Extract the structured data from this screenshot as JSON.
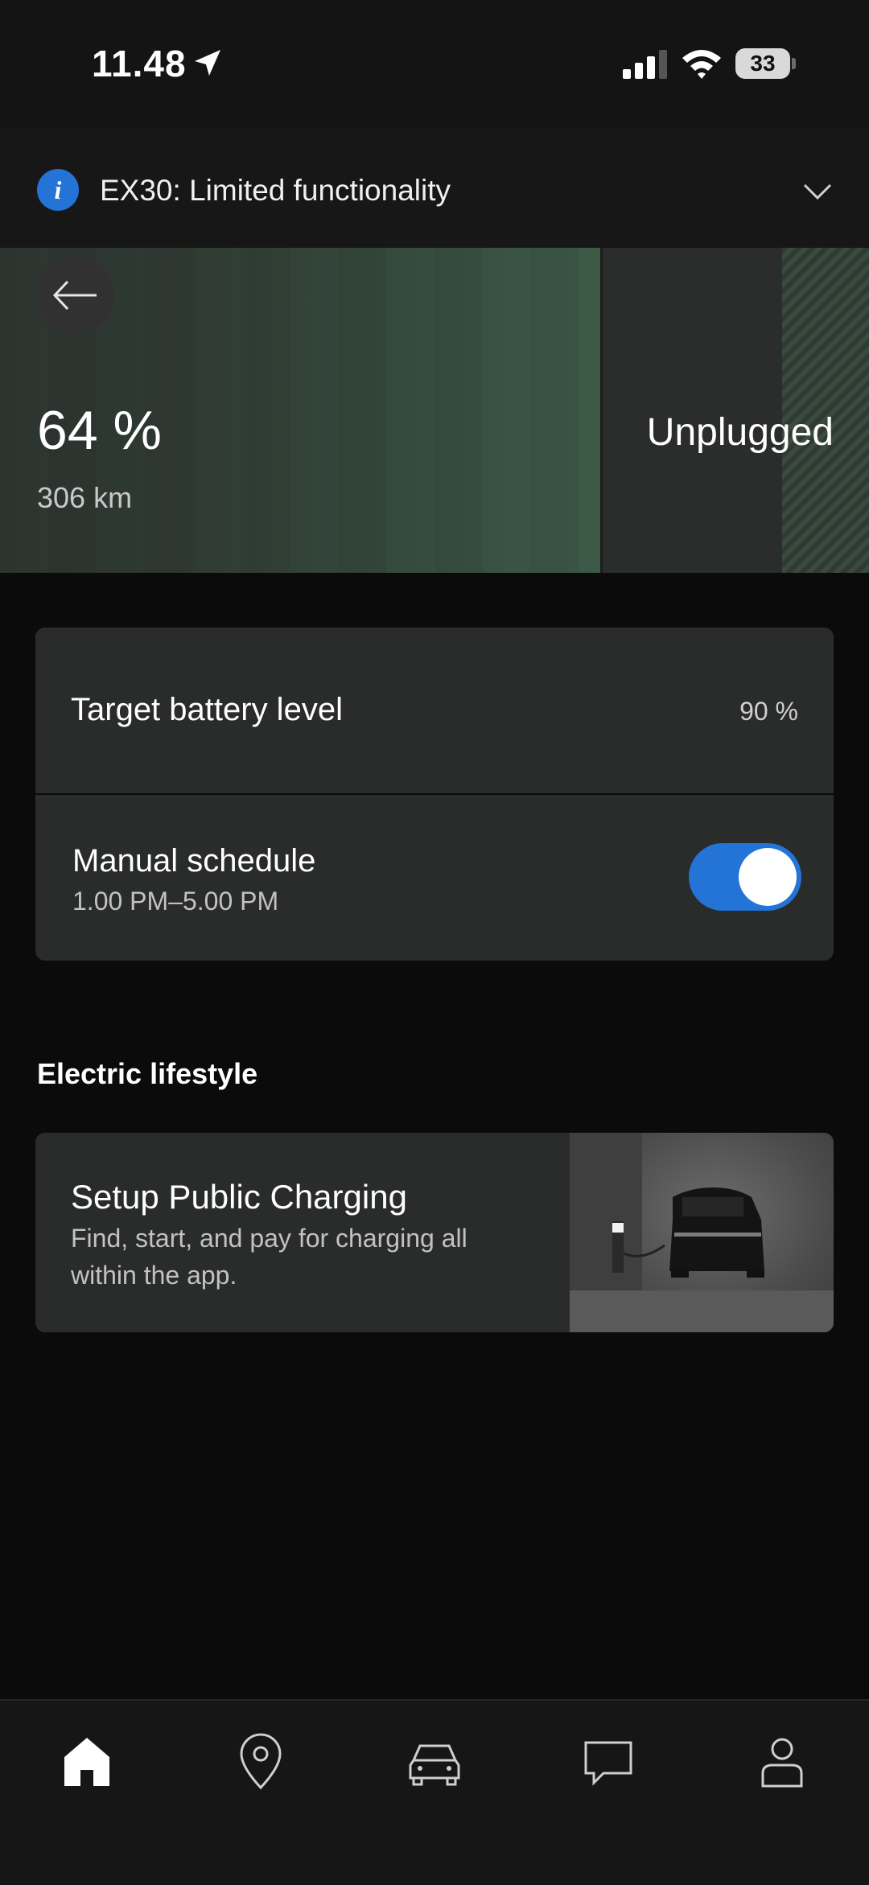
{
  "status_bar": {
    "time": "11.48",
    "battery_level": "33"
  },
  "banner": {
    "text": "EX30: Limited functionality",
    "info_icon_glyph": "i"
  },
  "charge": {
    "percent_text": "64 %",
    "percent_value": 0.64,
    "range": "306 km",
    "status": "Unplugged",
    "fill_color": "#3d5a47"
  },
  "settings": {
    "target_label": "Target battery level",
    "target_value": "90 %",
    "target_fraction": 0.9,
    "schedule_title": "Manual schedule",
    "schedule_time": "1.00 PM–5.00 PM",
    "schedule_enabled": true
  },
  "lifestyle": {
    "section_title": "Electric lifestyle",
    "promo_title": "Setup Public Charging",
    "promo_desc": "Find, start, and pay for charging all within the app."
  },
  "nav": {
    "items": [
      "home-icon",
      "map-pin-icon",
      "car-icon",
      "chat-icon",
      "profile-icon"
    ],
    "active": "home-icon"
  },
  "colors": {
    "accent": "#2473d6",
    "background": "#0b0b0b",
    "card": "#2a2b2b"
  }
}
